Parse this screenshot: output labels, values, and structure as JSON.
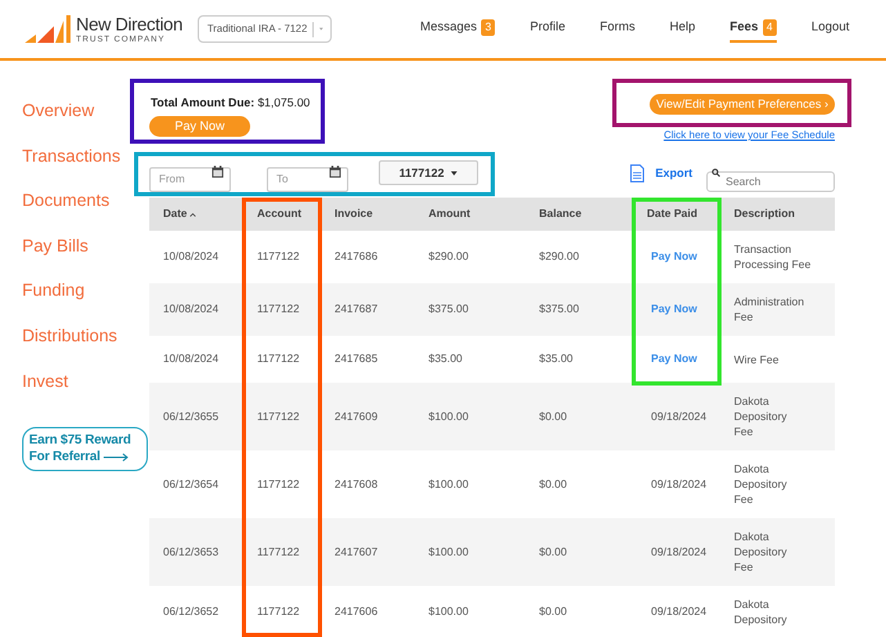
{
  "header": {
    "logo": {
      "name": "New Direction",
      "tagline": "TRUST COMPANY"
    },
    "account_select": {
      "value": "Traditional IRA - 7122"
    },
    "nav": [
      {
        "label": "Messages",
        "badge": "3",
        "selected": false
      },
      {
        "label": "Profile",
        "selected": false
      },
      {
        "label": "Forms",
        "selected": false
      },
      {
        "label": "Help",
        "selected": false
      },
      {
        "label": "Fees",
        "badge": "4",
        "selected": true
      },
      {
        "label": "Logout",
        "selected": false
      }
    ]
  },
  "sidebar": {
    "items": [
      "Overview",
      "Transactions",
      "Documents",
      "Pay Bills",
      "Funding",
      "Distributions",
      "Invest"
    ],
    "referral": "Earn $75 Reward For Referral"
  },
  "summary": {
    "label": "Total Amount Due:",
    "value": "$1,075.00",
    "button": "Pay Now"
  },
  "preferences_button": "View/Edit Payment Preferences ›",
  "fee_schedule_link": "Click here to view your Fee Schedule",
  "filters": {
    "from": {
      "placeholder": "From"
    },
    "to": {
      "placeholder": "To"
    },
    "account": {
      "value": "1177122"
    }
  },
  "export": "Export",
  "search": {
    "placeholder": "Search"
  },
  "table": {
    "columns": [
      {
        "label": "Date",
        "sorted": true
      },
      {
        "label": "Account",
        "sorted": false
      },
      {
        "label": "Invoice",
        "sorted": false
      },
      {
        "label": "Amount",
        "sorted": false
      },
      {
        "label": "Balance",
        "sorted": false
      },
      {
        "label": "Date Paid",
        "sorted": false
      },
      {
        "label": "Description",
        "sorted": false
      }
    ],
    "rows": [
      {
        "date": "10/08/2024",
        "account": "1177122",
        "invoice": "2417686",
        "amount": "$290.00",
        "balance": "$290.00",
        "date_paid": {
          "kind": "link",
          "text": "Pay Now"
        },
        "description": [
          "Transaction",
          "Processing Fee"
        ]
      },
      {
        "date": "10/08/2024",
        "account": "1177122",
        "invoice": "2417687",
        "amount": "$375.00",
        "balance": "$375.00",
        "date_paid": {
          "kind": "link",
          "text": "Pay Now"
        },
        "description": [
          "Administration",
          "Fee"
        ]
      },
      {
        "date": "10/08/2024",
        "account": "1177122",
        "invoice": "2417685",
        "amount": "$35.00",
        "balance": "$35.00",
        "date_paid": {
          "kind": "link",
          "text": "Pay Now"
        },
        "description": [
          "Wire Fee"
        ]
      },
      {
        "date": "06/12/3655",
        "account": "1177122",
        "invoice": "2417609",
        "amount": "$100.00",
        "balance": "$0.00",
        "date_paid": {
          "kind": "text",
          "text": "09/18/2024"
        },
        "description": [
          "Dakota",
          "Depository",
          "Fee"
        ]
      },
      {
        "date": "06/12/3654",
        "account": "1177122",
        "invoice": "2417608",
        "amount": "$100.00",
        "balance": "$0.00",
        "date_paid": {
          "kind": "text",
          "text": "09/18/2024"
        },
        "description": [
          "Dakota",
          "Depository",
          "Fee"
        ]
      },
      {
        "date": "06/12/3653",
        "account": "1177122",
        "invoice": "2417607",
        "amount": "$100.00",
        "balance": "$0.00",
        "date_paid": {
          "kind": "text",
          "text": "09/18/2024"
        },
        "description": [
          "Dakota",
          "Depository",
          "Fee"
        ]
      },
      {
        "date": "06/12/3652",
        "account": "1177122",
        "invoice": "2417606",
        "amount": "$100.00",
        "balance": "$0.00",
        "date_paid": {
          "kind": "text",
          "text": "09/18/2024"
        },
        "description": [
          "Dakota",
          "Depository"
        ]
      }
    ]
  },
  "annotations": [
    {
      "color": "#3d10b8"
    },
    {
      "color": "#a3146c"
    },
    {
      "color": "#10a7c8"
    },
    {
      "color": "#ff5100"
    },
    {
      "color": "#33e52e"
    }
  ]
}
